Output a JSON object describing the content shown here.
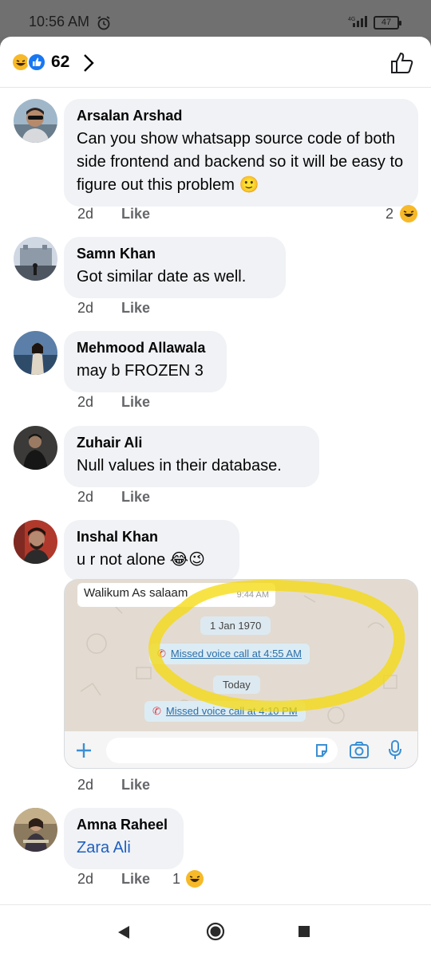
{
  "status": {
    "time": "10:56 AM",
    "battery": "47",
    "alarm_icon": "alarm-clock-icon",
    "signal_icon": "signal-bars-icon"
  },
  "header": {
    "reaction_count": "62",
    "reactions": [
      "haha-icon",
      "like-icon"
    ],
    "chevron_icon": "chevron-right-icon",
    "like_icon": "thumbs-up-outline-icon"
  },
  "comments": [
    {
      "author": "Arsalan Arshad",
      "text": "Can you show whatsapp source code of both side frontend and backend so it will be easy to figure out this problem 🙂",
      "time": "2d",
      "like": "Like",
      "reactions": "2"
    },
    {
      "author": "Samn Khan",
      "text": "Got similar date as well.",
      "time": "2d",
      "like": "Like"
    },
    {
      "author": "Mehmood Allawala",
      "text": "may b FROZEN 3",
      "time": "2d",
      "like": "Like"
    },
    {
      "author": "Zuhair Ali",
      "text": "Null values in their database.",
      "time": "2d",
      "like": "Like"
    },
    {
      "author": "Inshal Khan",
      "text": "u r not alone 😂😉",
      "time": "2d",
      "like": "Like"
    },
    {
      "author": "Amna Raheel",
      "text": "Zara Ali",
      "time": "2d",
      "like": "Like",
      "reactions": "1"
    }
  ],
  "attachment": {
    "greeting": "Walikum As salaam",
    "greeting_time": "9:44 AM",
    "date_1": "1 Jan 1970",
    "missed_1": "Missed voice call at 4:55 AM",
    "date_2": "Today",
    "missed_2": "Missed voice call at 4:10 PM",
    "highlight_color": "#f5d90a"
  },
  "nav": {
    "back_icon": "back-triangle-icon",
    "home_icon": "home-circle-icon",
    "recents_icon": "recents-square-icon"
  },
  "colors": {
    "like_blue": "#1877f2",
    "haha_yellow": "#f7b928",
    "bubble_grey": "#f0f2f5",
    "mention_blue": "#1f5fbf"
  }
}
